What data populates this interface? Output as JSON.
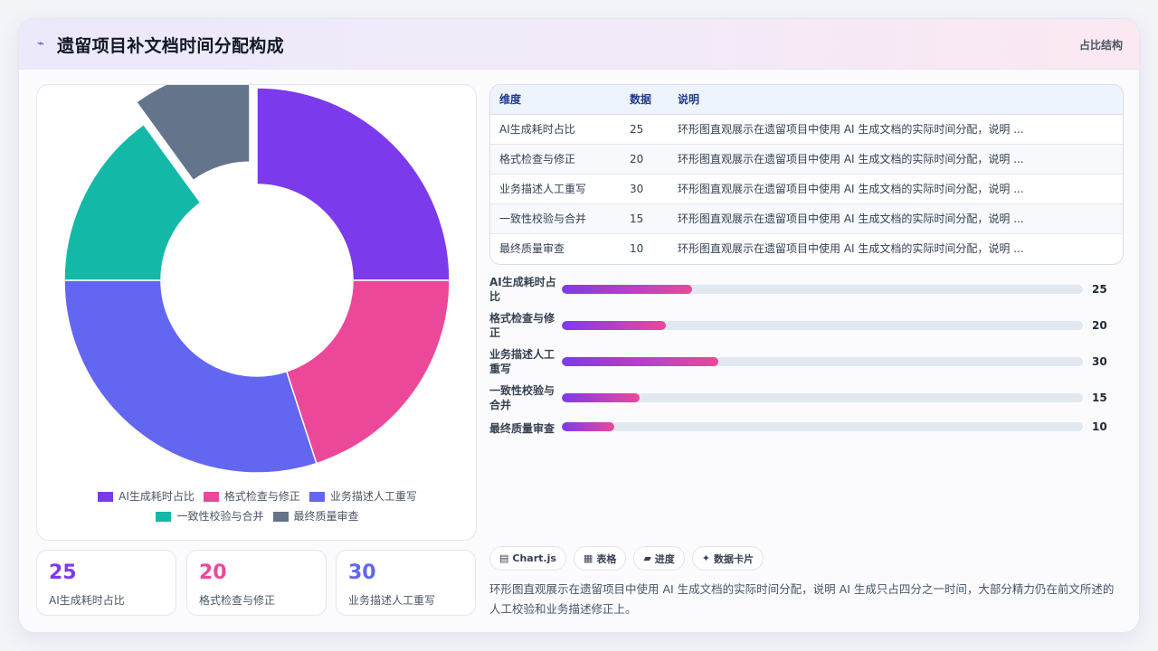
{
  "header": {
    "logo_glyph": "⌁",
    "title": "遗留项目补文档时间分配构成",
    "tag": "占比结构"
  },
  "chart_data": {
    "type": "pie",
    "categories": [
      "AI生成耗时占比",
      "格式检查与修正",
      "业务描述人工重写",
      "一致性校验与合并",
      "最终质量审查"
    ],
    "values": [
      25,
      20,
      30,
      15,
      10
    ],
    "colors": [
      "#7c3aed",
      "#ec4899",
      "#6366f1",
      "#14b8a6",
      "#64748b"
    ],
    "donut": true,
    "exploded_slice": "最终质量审查",
    "legend_position": "bottom"
  },
  "stats": [
    {
      "value": "25",
      "label": "AI生成耗时占比",
      "color": "#7c3aed"
    },
    {
      "value": "20",
      "label": "格式检查与修正",
      "color": "#ec4899"
    },
    {
      "value": "30",
      "label": "业务描述人工重写",
      "color": "#6366f1"
    }
  ],
  "table": {
    "headers": [
      "维度",
      "数据",
      "说明"
    ],
    "rows": [
      [
        "AI生成耗时占比",
        "25",
        "环形图直观展示在遗留项目中使用 AI 生成文档的实际时间分配，说明 ..."
      ],
      [
        "格式检查与修正",
        "20",
        "环形图直观展示在遗留项目中使用 AI 生成文档的实际时间分配，说明 ..."
      ],
      [
        "业务描述人工重写",
        "30",
        "环形图直观展示在遗留项目中使用 AI 生成文档的实际时间分配，说明 ..."
      ],
      [
        "一致性校验与合并",
        "15",
        "环形图直观展示在遗留项目中使用 AI 生成文档的实际时间分配，说明 ..."
      ],
      [
        "最终质量审查",
        "10",
        "环形图直观展示在遗留项目中使用 AI 生成文档的实际时间分配，说明 ..."
      ]
    ]
  },
  "bars": [
    {
      "label": "AI生成耗时占比",
      "value": 25
    },
    {
      "label": "格式检查与修正",
      "value": 20
    },
    {
      "label": "业务描述人工重写",
      "value": 30
    },
    {
      "label": "一致性校验与合并",
      "value": 15
    },
    {
      "label": "最终质量审查",
      "value": 10
    }
  ],
  "bar_max": 100,
  "chips": [
    {
      "icon": "▤",
      "label": "Chart.js"
    },
    {
      "icon": "▦",
      "label": "表格"
    },
    {
      "icon": "▰",
      "label": "进度"
    },
    {
      "icon": "✦",
      "label": "数据卡片"
    }
  ],
  "description": "环形图直观展示在遗留项目中使用 AI 生成文档的实际时间分配，说明 AI 生成只占四分之一时间，大部分精力仍在前文所述的人工校验和业务描述修正上。"
}
